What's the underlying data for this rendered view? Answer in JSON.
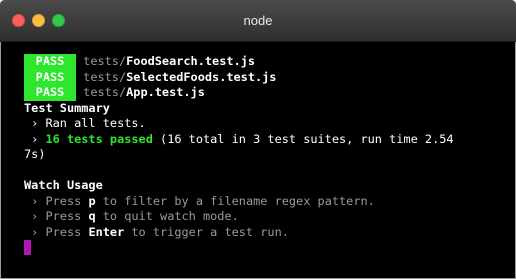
{
  "window": {
    "title": "node"
  },
  "terminal": {
    "results": [
      {
        "status": "PASS",
        "dir": "tests/",
        "file": "FoodSearch.test.js"
      },
      {
        "status": "PASS",
        "dir": "tests/",
        "file": "SelectedFoods.test.js"
      },
      {
        "status": "PASS",
        "dir": "tests/",
        "file": "App.test.js"
      }
    ],
    "summary_heading": "Test Summary",
    "ran_line": " › Ran all tests.",
    "passed_prefix": " › ",
    "passed_highlight": "16 tests passed",
    "passed_rest": " (16 total in 3 test suites, run time 2.54",
    "passed_wrap": "7s)",
    "watch_heading": "Watch Usage",
    "watch_items": [
      {
        "prefix": " › Press ",
        "key": "p",
        "suffix": " to filter by a filename regex pattern."
      },
      {
        "prefix": " › Press ",
        "key": "q",
        "suffix": " to quit watch mode."
      },
      {
        "prefix": " › Press ",
        "key": "Enter",
        "suffix": " to trigger a test run."
      }
    ]
  },
  "colors": {
    "pass_badge": "#2ee62e",
    "cursor": "#b016b0",
    "background": "#000000"
  }
}
